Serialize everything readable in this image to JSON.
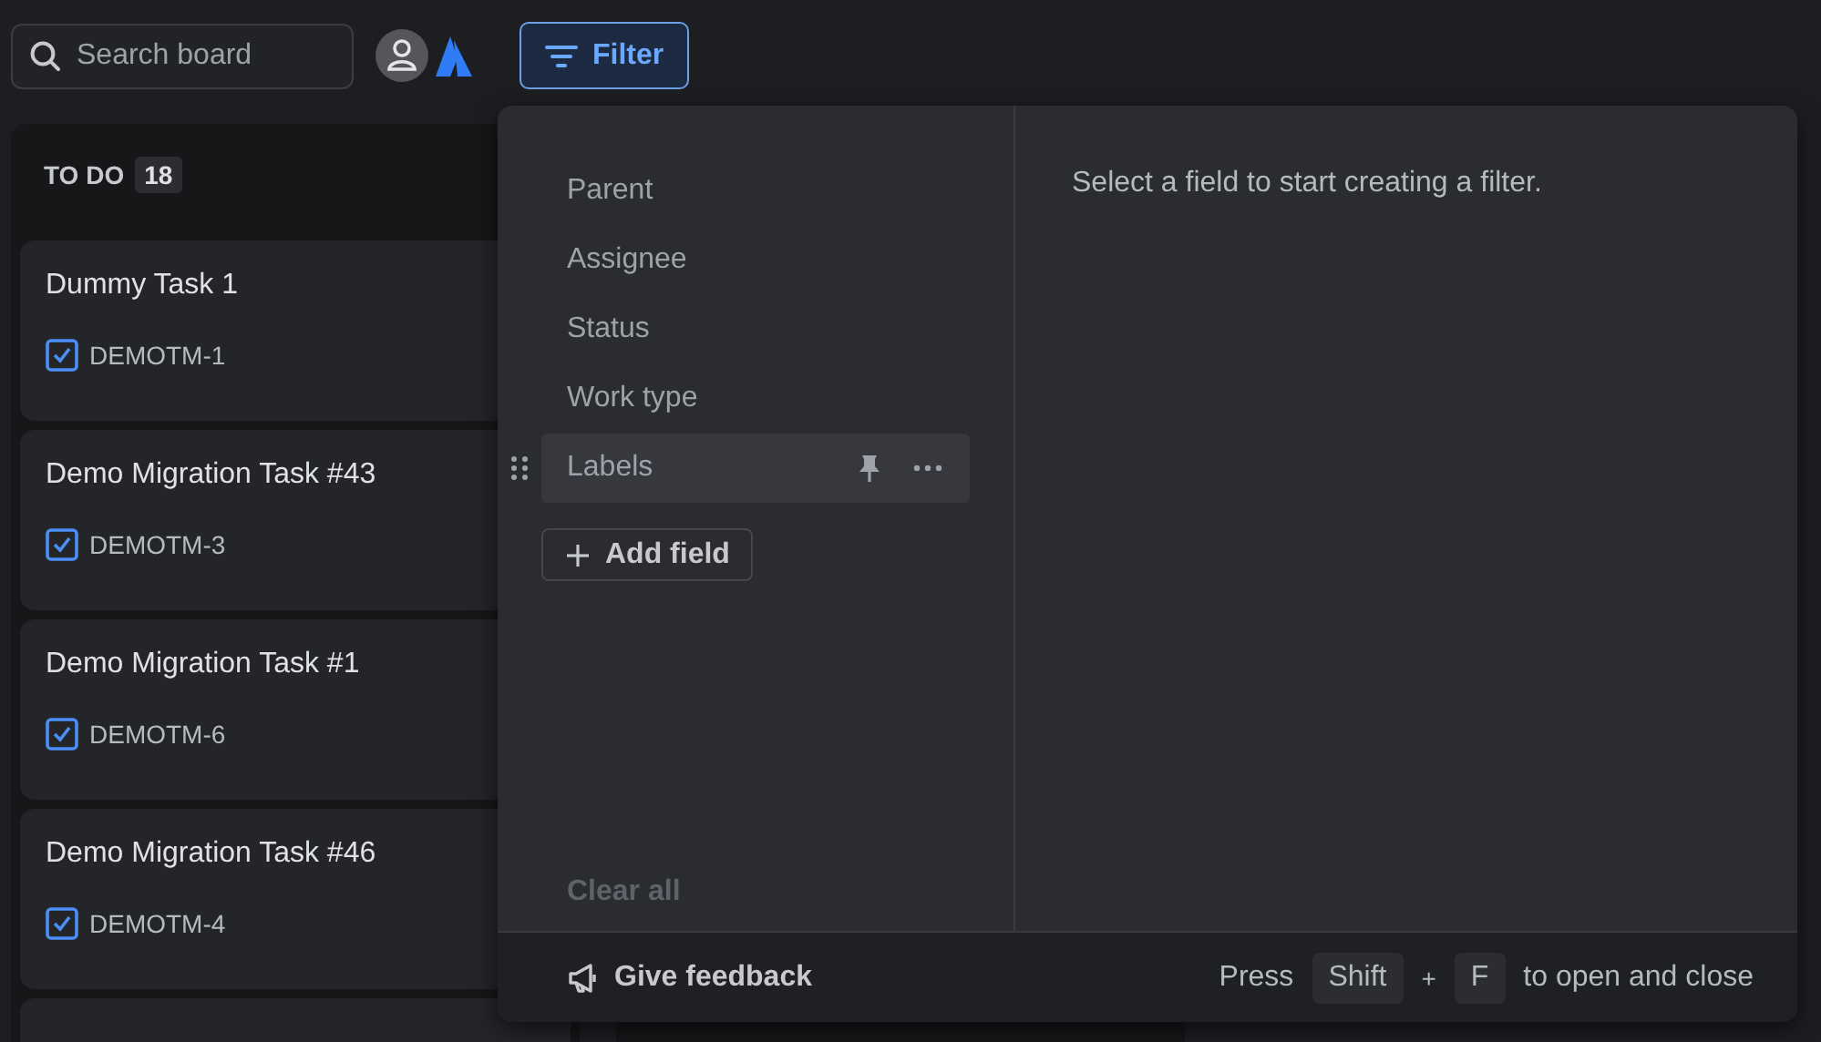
{
  "search": {
    "placeholder": "Search board"
  },
  "filter_button": {
    "label": "Filter",
    "active": true
  },
  "columns": [
    {
      "title": "TO DO",
      "count": "18",
      "cards": [
        {
          "title": "Dummy Task 1",
          "key": "DEMOTM-1"
        },
        {
          "title": "Demo Migration Task #43",
          "key": "DEMOTM-3"
        },
        {
          "title": "Demo Migration Task #1",
          "key": "DEMOTM-6"
        },
        {
          "title": "Demo Migration Task #46",
          "key": "DEMOTM-4"
        }
      ]
    }
  ],
  "filter_popup": {
    "fields": [
      {
        "label": "Parent",
        "hovered": false
      },
      {
        "label": "Assignee",
        "hovered": false
      },
      {
        "label": "Status",
        "hovered": false
      },
      {
        "label": "Work type",
        "hovered": false
      },
      {
        "label": "Labels",
        "hovered": true
      }
    ],
    "add_field": "Add field",
    "clear_all": "Clear all",
    "message": "Select a field to start creating a filter.",
    "feedback": "Give feedback",
    "shortcut_prefix": "Press",
    "keys": [
      "Shift",
      "F"
    ],
    "key_joiner": "+",
    "shortcut_suffix": "to open and close"
  }
}
